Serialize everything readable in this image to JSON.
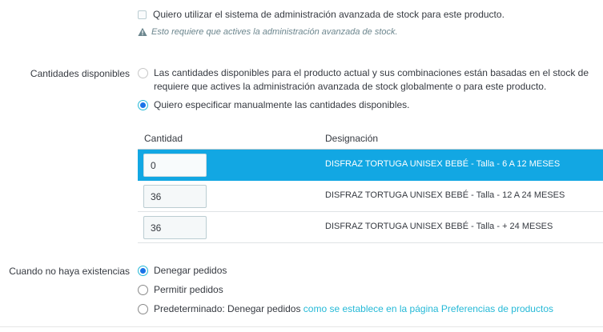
{
  "advanced_stock": {
    "checkbox_label": "Quiero utilizar el sistema de administración avanzada de stock para este producto.",
    "warning": "Esto requiere que actives la administración avanzada de stock."
  },
  "available_quantities": {
    "label": "Cantidades disponibles",
    "option_based_on_stock": "Las cantidades disponibles para el producto actual y sus combinaciones están basadas en el stock de",
    "option_based_on_stock_line2": "requiere que actives la administración avanzada de stock globalmente o para este producto.",
    "option_manual": "Quiero especificar manualmente las cantidades disponibles.",
    "selected": "manual"
  },
  "table": {
    "headers": {
      "quantity": "Cantidad",
      "designation": "Designación"
    },
    "rows": [
      {
        "quantity": "0",
        "designation": "DISFRAZ TORTUGA UNISEX BEBÉ - Talla - 6 A 12 MESES",
        "selected": true
      },
      {
        "quantity": "36",
        "designation": "DISFRAZ TORTUGA UNISEX BEBÉ - Talla - 12 A 24 MESES",
        "selected": false
      },
      {
        "quantity": "36",
        "designation": "DISFRAZ TORTUGA UNISEX BEBÉ - Talla - + 24 MESES",
        "selected": false
      }
    ]
  },
  "out_of_stock": {
    "label": "Cuando no haya existencias",
    "deny": "Denegar pedidos",
    "allow": "Permitir pedidos",
    "default_prefix": "Predeterminado: Denegar pedidos",
    "default_link": "como se establece en la página Preferencias de productos",
    "selected": "deny"
  },
  "colors": {
    "accent": "#25b9d7",
    "selected_row": "#12a7e3",
    "text": "#363a41",
    "muted": "#6c868e"
  },
  "icons": {
    "warning": "warning-icon"
  }
}
